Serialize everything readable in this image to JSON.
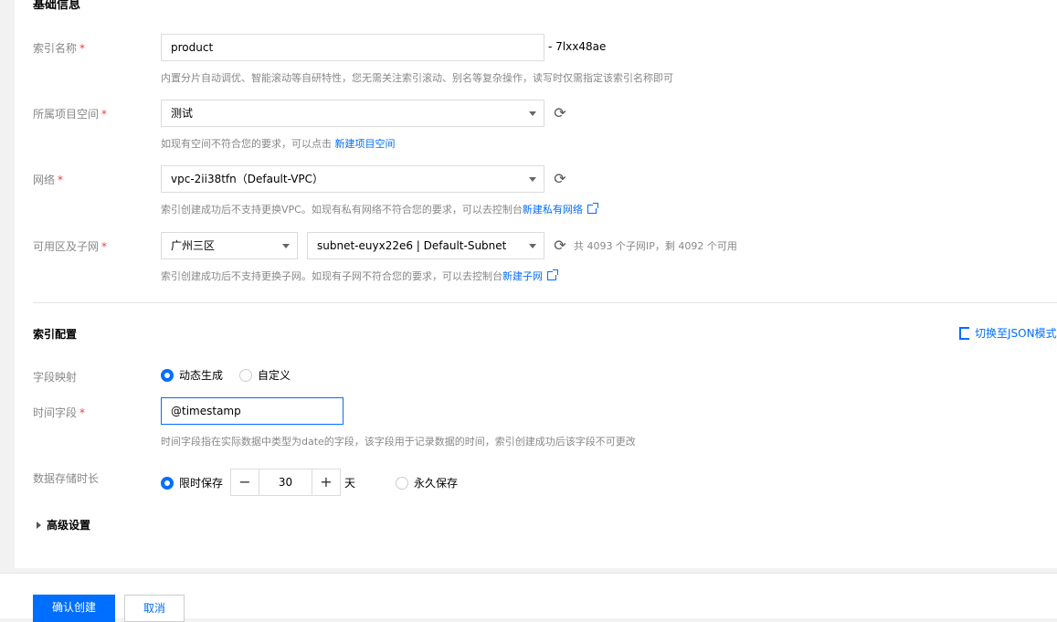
{
  "section_basic": {
    "title": "基础信息"
  },
  "index_name": {
    "label": "索引名称",
    "value": "product",
    "suffix": "- 7lxx48ae",
    "hint": "内置分片自动调优、智能滚动等自研特性，您无需关注索引滚动、别名等复杂操作，读写时仅需指定该索引名称即可"
  },
  "project": {
    "label": "所属项目空间",
    "value": "测试",
    "hint": "如现有空间不符合您的要求，可以点击",
    "link": "新建项目空间"
  },
  "network": {
    "label": "网络",
    "value": "vpc-2ii38tfn（Default-VPC）",
    "hint": "索引创建成功后不支持更换VPC。如现有私有网络不符合您的要求，可以去控制台",
    "link": "新建私有网络"
  },
  "zone_subnet": {
    "label": "可用区及子网",
    "zone": "广州三区",
    "subnet": "subnet-euyx22e6 | Default-Subnet",
    "ip_info": "共 4093 个子网IP，剩 4092 个可用",
    "hint": "索引创建成功后不支持更换子网。如现有子网不符合您的要求，可以去控制台",
    "link": "新建子网"
  },
  "index_config": {
    "title": "索引配置",
    "switch_json": "切换至JSON模式"
  },
  "field_mapping": {
    "label": "字段映射",
    "options": [
      "动态生成",
      "自定义"
    ],
    "selected": "动态生成"
  },
  "time_field": {
    "label": "时间字段",
    "value": "@timestamp",
    "hint": "时间字段指在实际数据中类型为date的字段，该字段用于记录数据的时间，索引创建成功后该字段不可更改"
  },
  "retention": {
    "label": "数据存储时长",
    "option_limited": "限时保存",
    "days": "30",
    "unit": "天",
    "option_forever": "永久保存",
    "selected": "限时保存"
  },
  "advanced": {
    "label": "高级设置"
  },
  "footer": {
    "confirm": "确认创建",
    "cancel": "取消"
  },
  "colors": {
    "accent": "#006eff",
    "required": "#e54545"
  }
}
